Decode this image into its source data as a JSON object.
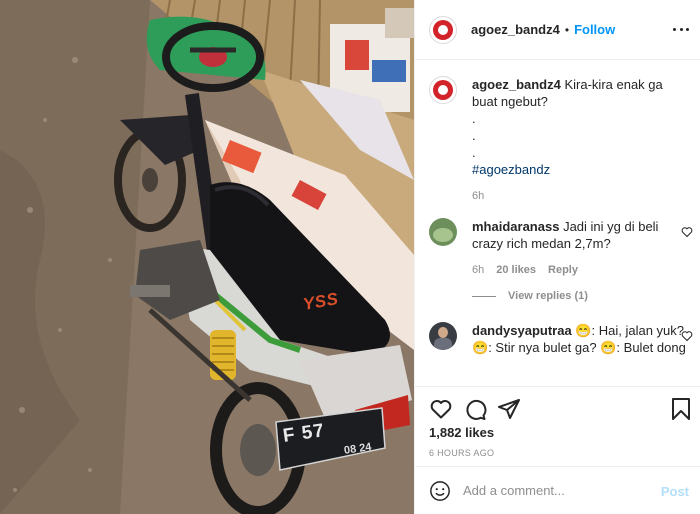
{
  "post": {
    "username": "agoez_bandz4",
    "follow_label": "Follow",
    "separator": "•"
  },
  "caption": {
    "username": "agoez_bandz4",
    "text": "Kira-kira enak ga buat ngebut?",
    "dots": [
      ".",
      ".",
      "."
    ],
    "hashtag": "#agoezbandz",
    "time": "6h"
  },
  "comments": [
    {
      "username": "mhaidaranass",
      "text": "Jadi ini yg di beli crazy rich medan 2,7m?",
      "time": "6h",
      "likes": "20 likes",
      "reply_label": "Reply",
      "view_replies": "View replies (1)"
    },
    {
      "username": "dandysyaputraa",
      "text_1": "Hai, jalan yuk?",
      "text_2": "Stir nya bulet ga?",
      "text_3": "Bulet dong",
      "emoji": "😁"
    }
  ],
  "stats": {
    "likes": "1,882 likes",
    "ago": "6 HOURS AGO"
  },
  "add_comment": {
    "placeholder": "Add a comment...",
    "post_label": "Post"
  },
  "photo": {
    "plate_main": "F 57",
    "plate_sub": "08 24",
    "brand": "YSS"
  },
  "colors": {
    "accent": "#0095f6",
    "post_disabled": "#b2dffc",
    "hashtag": "#00376b",
    "muted": "#8e8e8e"
  },
  "icons": [
    "more-options-icon",
    "heart-icon",
    "comment-icon",
    "share-icon",
    "bookmark-icon",
    "emoji-icon"
  ]
}
